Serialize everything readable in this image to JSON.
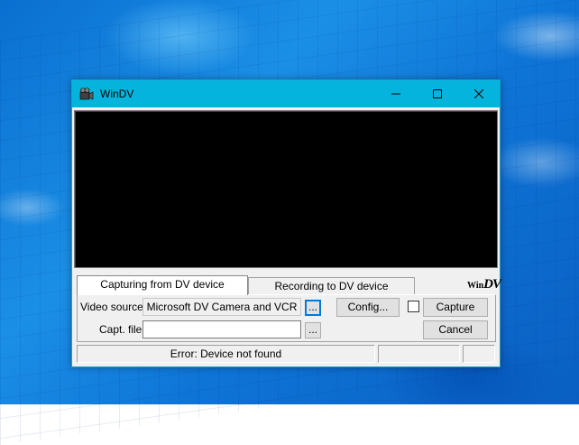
{
  "window": {
    "title": "WinDV",
    "icon": "film-camera-icon"
  },
  "tabs": [
    {
      "label": "Capturing from DV device",
      "selected": true
    },
    {
      "label": "Recording to DV device",
      "selected": false
    }
  ],
  "logo": {
    "prefix": "Win",
    "suffix": "DV"
  },
  "form": {
    "video_source_label": "Video source:",
    "video_source_value": "Microsoft DV Camera and VCR",
    "browse_label": "...",
    "config_label": "Config...",
    "capture_checkbox_checked": false,
    "capture_label": "Capture",
    "capt_file_label": "Capt. file:",
    "capt_file_value": "",
    "cancel_label": "Cancel"
  },
  "status": {
    "message": "Error: Device not found",
    "cell2": "",
    "cell3": ""
  }
}
